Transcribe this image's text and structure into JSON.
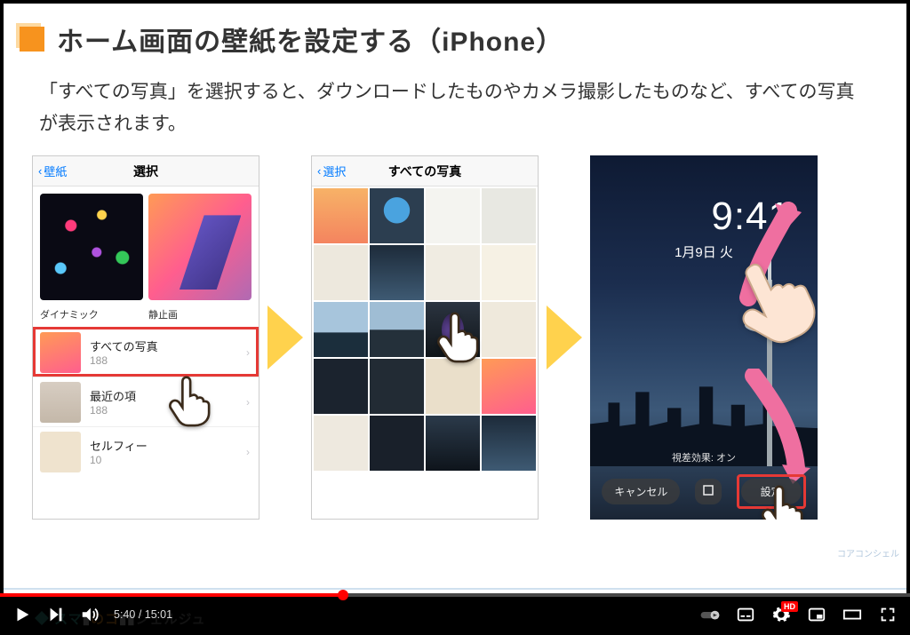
{
  "slide": {
    "title": "ホーム画面の壁紙を設定する（iPhone）",
    "description": "「すべての写真」を選択すると、ダウンロードしたものやカメラ撮影したものなど、すべての写真が表示されます。"
  },
  "screen1": {
    "back": "壁紙",
    "title": "選択",
    "label_dynamic": "ダイナミック",
    "label_static": "静止画",
    "albums": [
      {
        "name": "すべての写真",
        "count": "188"
      },
      {
        "name": "最近の項",
        "count": "188"
      },
      {
        "name": "セルフィー",
        "count": "10"
      }
    ]
  },
  "screen2": {
    "back": "選択",
    "title": "すべての写真"
  },
  "screen3": {
    "time": "9:41",
    "date": "1月9日 火",
    "parallax": "視差効果: オン",
    "cancel": "キャンセル",
    "set": "設定"
  },
  "player": {
    "current": "5:40",
    "sep": " / ",
    "duration": "15:01",
    "hd": "HD",
    "progress_pct": 37.7
  },
  "brand_a": "スマ",
  "brand_b": "のコ",
  "brand_c": "シェルジュ",
  "watermark": "コアコンシェル"
}
